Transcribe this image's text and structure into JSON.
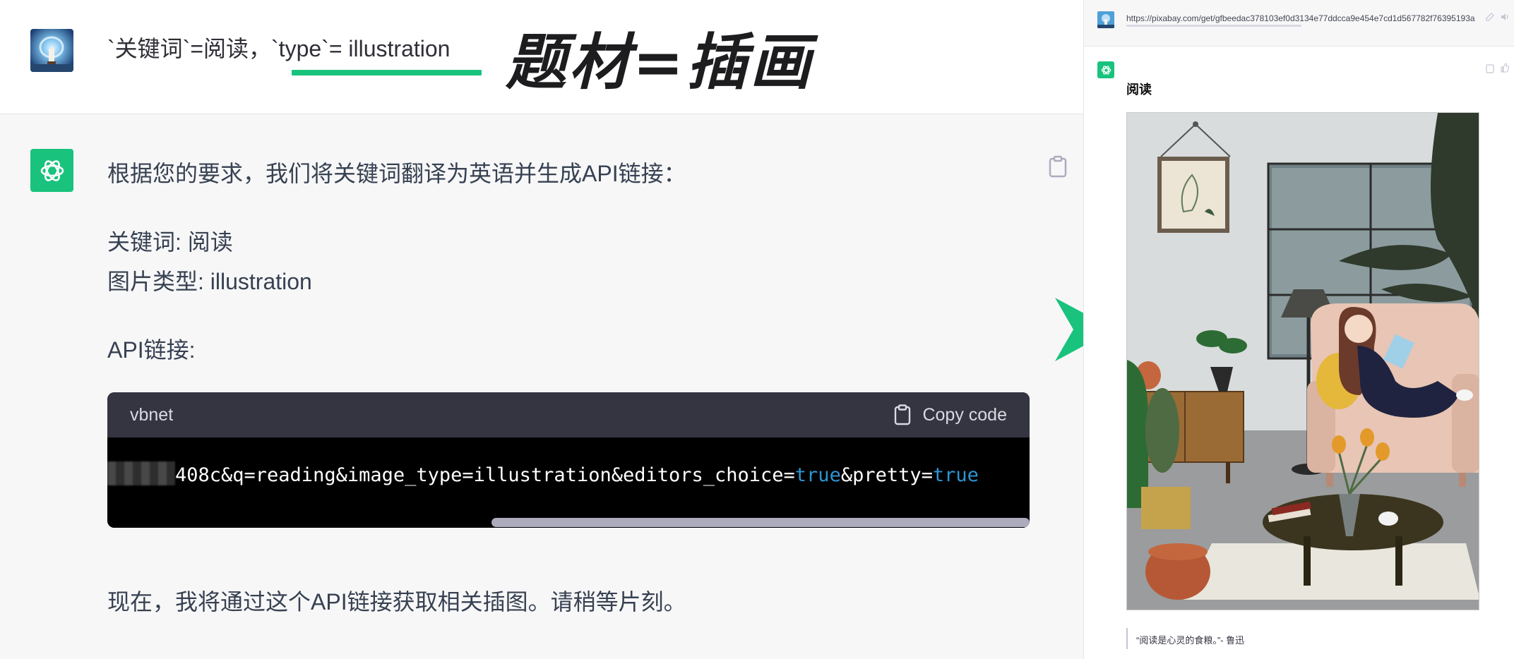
{
  "user_message": {
    "prompt_part1": "`关键词`=阅读，",
    "prompt_part2": "`type`= illustration",
    "caption": "题材=插画"
  },
  "assistant_message": {
    "intro": "根据您的要求，我们将关键词翻译为英语并生成API链接：",
    "keyword_line": "关键词: 阅读",
    "type_line": "图片类型: illustration",
    "api_label": "API链接:",
    "code": {
      "language": "vbnet",
      "copy_label": "Copy code",
      "segment_a": "408c&q=reading&image_type=illustration&editors_choice=",
      "kw_true_1": "true",
      "segment_b": "&pretty=",
      "kw_true_2": "true"
    },
    "closing": "现在，我将通过这个API链接获取相关插图。请稍等片刻。"
  },
  "right_panel": {
    "url": "https://pixabay.com/get/gfbeedac378103ef0d3134e77ddcca9e454e7cd1d567782f76395193a",
    "title": "阅读",
    "quote": "“阅读是心灵的食粮。”- 鲁迅"
  },
  "colors": {
    "accent_green": "#19c37d",
    "code_header": "#343541",
    "code_keyword": "#2e95d3",
    "panel_bg": "#f7f7f8"
  },
  "icons": [
    "user-avatar-icon",
    "openai-logo-icon",
    "clipboard-icon",
    "play-arrow-icon",
    "edit-icon",
    "speaker-icon",
    "thumbs-up-icon"
  ]
}
